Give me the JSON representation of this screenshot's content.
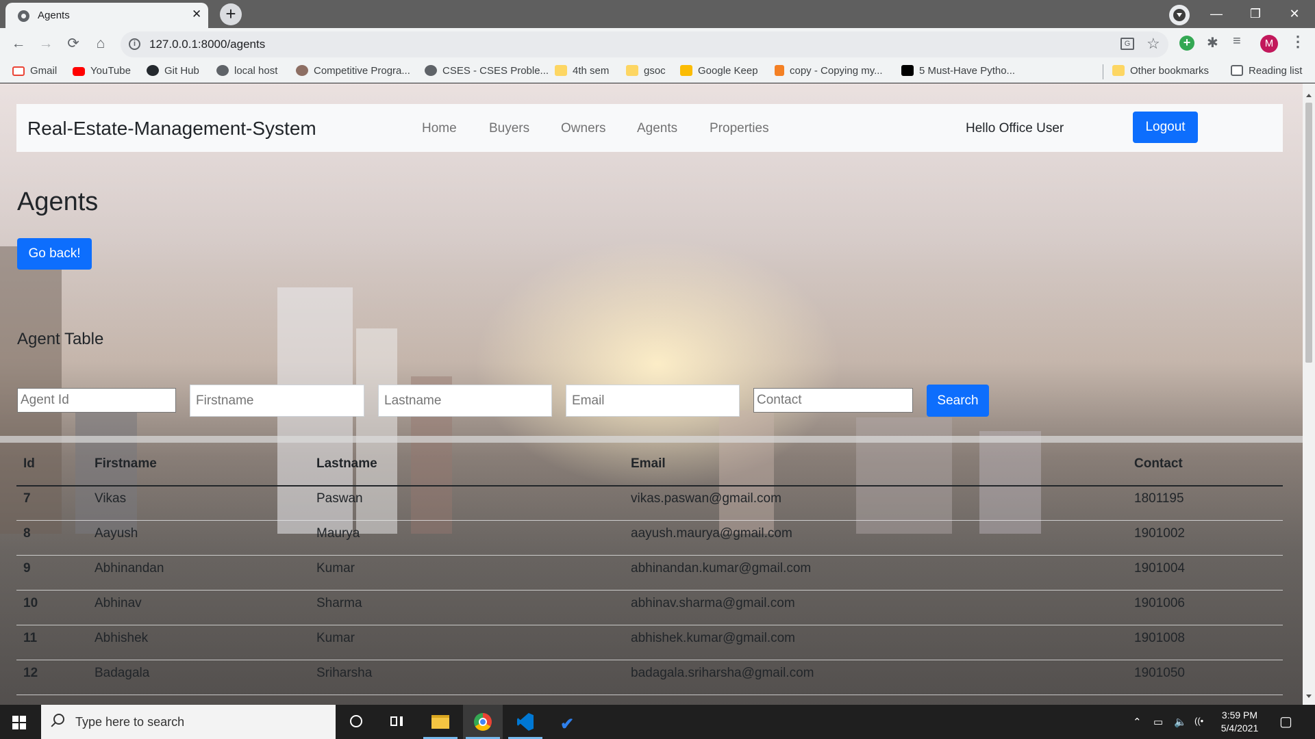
{
  "browser": {
    "tab_title": "Agents",
    "tab_close": "✕",
    "new_tab": "+",
    "url": "127.0.0.1:8000/agents",
    "avatar_letter": "M",
    "window_controls": {
      "minimize": "—",
      "restore": "❐",
      "close": "✕"
    },
    "nav": {
      "back": "←",
      "forward": "→",
      "reload": "⟳",
      "home": "⌂"
    },
    "bookmarks": [
      {
        "label": "Gmail",
        "icon": "gmail-icon",
        "color": "#ea4335"
      },
      {
        "label": "YouTube",
        "icon": "youtube-icon",
        "color": "#ff0000"
      },
      {
        "label": "Git Hub",
        "icon": "github-icon",
        "color": "#24292e"
      },
      {
        "label": "local host",
        "icon": "globe-icon",
        "color": "#5f6368"
      },
      {
        "label": "Competitive Progra...",
        "icon": "bookmark-favicon-icon",
        "color": "#8d6e63"
      },
      {
        "label": "CSES - CSES Proble...",
        "icon": "globe-icon",
        "color": "#5f6368"
      },
      {
        "label": "4th sem",
        "icon": "folder-icon",
        "color": "#fdd663"
      },
      {
        "label": "gsoc",
        "icon": "folder-icon",
        "color": "#fdd663"
      },
      {
        "label": "Google Keep",
        "icon": "keep-icon",
        "color": "#fbbc04"
      },
      {
        "label": "copy - Copying my...",
        "icon": "stackoverflow-icon",
        "color": "#f48024"
      },
      {
        "label": "5 Must-Have Pytho...",
        "icon": "medium-icon",
        "color": "#000000"
      }
    ],
    "other_bookmarks": "Other bookmarks",
    "reading_list": "Reading list"
  },
  "app": {
    "brand": "Real-Estate-Management-System",
    "nav_links": [
      "Home",
      "Buyers",
      "Owners",
      "Agents",
      "Properties"
    ],
    "greeting": "Hello Office User",
    "logout_label": "Logout",
    "page_title": "Agents",
    "go_back_label": "Go back!",
    "table_title": "Agent Table",
    "filters": {
      "agent_id_placeholder": "Agent Id",
      "firstname_placeholder": "Firstname",
      "lastname_placeholder": "Lastname",
      "email_placeholder": "Email",
      "contact_placeholder": "Contact",
      "search_label": "Search"
    },
    "table": {
      "columns": [
        "Id",
        "Firstname",
        "Lastname",
        "Email",
        "Contact"
      ],
      "rows": [
        [
          "7",
          "Vikas",
          "Paswan",
          "vikas.paswan@gmail.com",
          "1801195"
        ],
        [
          "8",
          "Aayush",
          "Maurya",
          "aayush.maurya@gmail.com",
          "1901002"
        ],
        [
          "9",
          "Abhinandan",
          "Kumar",
          "abhinandan.kumar@gmail.com",
          "1901004"
        ],
        [
          "10",
          "Abhinav",
          "Sharma",
          "abhinav.sharma@gmail.com",
          "1901006"
        ],
        [
          "11",
          "Abhishek",
          "Kumar",
          "abhishek.kumar@gmail.com",
          "1901008"
        ],
        [
          "12",
          "Badagala",
          "Sriharsha",
          "badagala.sriharsha@gmail.com",
          "1901050"
        ]
      ]
    },
    "colors": {
      "primary": "#0d6efd",
      "navbar_bg": "#f8f9fa"
    }
  },
  "taskbar": {
    "search_placeholder": "Type here to search",
    "time": "3:59 PM",
    "date": "5/4/2021"
  }
}
